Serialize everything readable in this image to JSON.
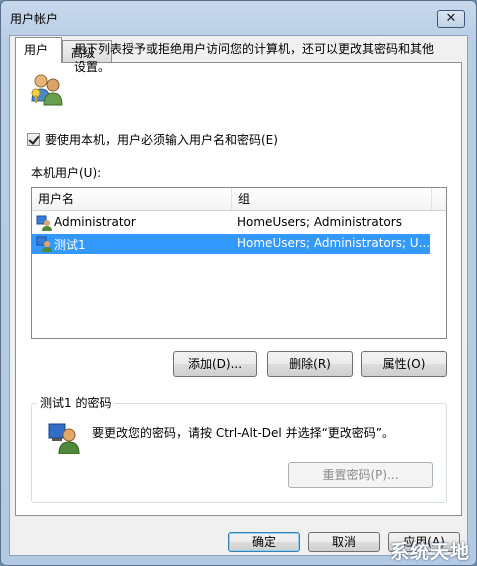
{
  "window": {
    "title": "用户帐户",
    "close_glyph": "✕"
  },
  "tabs": [
    {
      "label": "用户"
    },
    {
      "label": "高级"
    }
  ],
  "intro": {
    "text": "用下列表授予或拒绝用户访问您的计算机，还可以更改其密码和其他设置。"
  },
  "require_login": {
    "checked": true,
    "label": "要使用本机，用户必须输入用户名和密码(E)"
  },
  "users_section": {
    "label": "本机用户(U):"
  },
  "users_table": {
    "columns": [
      "用户名",
      "组"
    ],
    "rows": [
      {
        "name": "Administrator",
        "groups": "HomeUsers; Administrators",
        "selected": false
      },
      {
        "name": "测试1",
        "groups": "HomeUsers; Administrators; U...",
        "selected": true
      }
    ]
  },
  "user_buttons": {
    "add": "添加(D)...",
    "remove": "删除(R)",
    "properties": "属性(O)"
  },
  "password_group": {
    "title": "测试1 的密码",
    "text": "要更改您的密码，请按 Ctrl-Alt-Del 并选择“更改密码”。",
    "reset_button": "重置密码(P)..."
  },
  "dialog_buttons": {
    "ok": "确定",
    "cancel": "取消",
    "apply": "应用(A)"
  },
  "watermark": "系统天地",
  "colors": {
    "selection": "#3399ff",
    "title_bg": "#b8cde6",
    "default_button_border": "#3c7fb1"
  }
}
